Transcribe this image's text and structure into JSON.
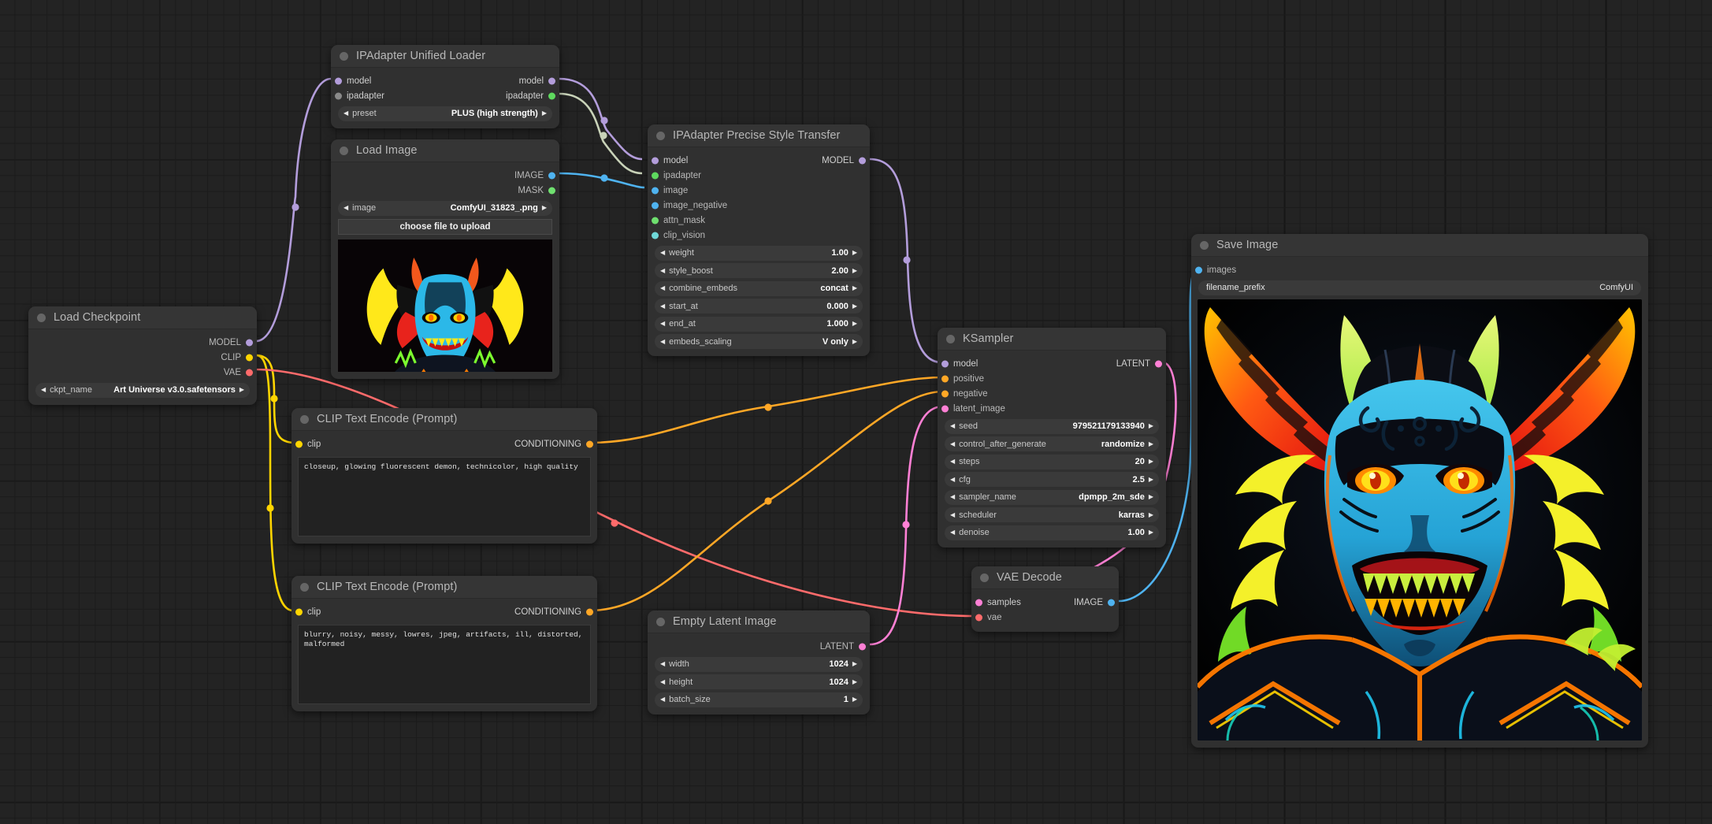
{
  "app": {
    "name": "ComfyUI",
    "canvas_bg": "#232323"
  },
  "colors": {
    "model": "#B39DDB",
    "clip": "#FFD500",
    "vae": "#FF6B6B",
    "conditioning": "#FFA726",
    "latent": "#FF80D5",
    "image": "#4FB3F0",
    "mask": "#6FE06F",
    "ipadapter": "#5ED95E",
    "clip_vision": "#6FD8D8"
  },
  "nodes": {
    "ipadapter_unified_loader": {
      "title": "IPAdapter Unified Loader",
      "inputs": [
        {
          "label": "model",
          "color": "#B39DDB"
        },
        {
          "label": "ipadapter",
          "color": "#8a8a8a"
        }
      ],
      "outputs": [
        {
          "label": "model",
          "color": "#B39DDB"
        },
        {
          "label": "ipadapter",
          "color": "#5ED95E"
        }
      ],
      "widgets": [
        {
          "label": "preset",
          "value": "PLUS (high strength)"
        }
      ]
    },
    "load_image": {
      "title": "Load Image",
      "outputs": [
        {
          "label": "IMAGE",
          "color": "#4FB3F0"
        },
        {
          "label": "MASK",
          "color": "#6FE06F"
        }
      ],
      "widgets": [
        {
          "label": "image",
          "value": "ComfyUI_31823_.png"
        }
      ],
      "upload_button": "choose file to upload",
      "preview_alt": "neon demon portrait thumbnail"
    },
    "ipadapter_precise_style_transfer": {
      "title": "IPAdapter Precise Style Transfer",
      "inputs": [
        {
          "label": "model",
          "color": "#B39DDB"
        },
        {
          "label": "ipadapter",
          "color": "#5ED95E"
        },
        {
          "label": "image",
          "color": "#4FB3F0"
        },
        {
          "label": "image_negative",
          "color": "#4FB3F0"
        },
        {
          "label": "attn_mask",
          "color": "#6FE06F"
        },
        {
          "label": "clip_vision",
          "color": "#6FD8D8"
        }
      ],
      "outputs": [
        {
          "label": "MODEL",
          "color": "#B39DDB"
        }
      ],
      "widgets": [
        {
          "label": "weight",
          "value": "1.00"
        },
        {
          "label": "style_boost",
          "value": "2.00"
        },
        {
          "label": "combine_embeds",
          "value": "concat"
        },
        {
          "label": "start_at",
          "value": "0.000"
        },
        {
          "label": "end_at",
          "value": "1.000"
        },
        {
          "label": "embeds_scaling",
          "value": "V only"
        }
      ]
    },
    "load_checkpoint": {
      "title": "Load Checkpoint",
      "outputs": [
        {
          "label": "MODEL",
          "color": "#B39DDB"
        },
        {
          "label": "CLIP",
          "color": "#FFD500"
        },
        {
          "label": "VAE",
          "color": "#FF6B6B"
        }
      ],
      "widgets": [
        {
          "label": "ckpt_name",
          "value": "Art Universe v3.0.safetensors"
        }
      ]
    },
    "clip_text_encode_positive": {
      "title": "CLIP Text Encode (Prompt)",
      "inputs": [
        {
          "label": "clip",
          "color": "#FFD500"
        }
      ],
      "outputs": [
        {
          "label": "CONDITIONING",
          "color": "#FFA726"
        }
      ],
      "text": "closeup, glowing fluorescent demon, technicolor, high quality"
    },
    "clip_text_encode_negative": {
      "title": "CLIP Text Encode (Prompt)",
      "inputs": [
        {
          "label": "clip",
          "color": "#FFD500"
        }
      ],
      "outputs": [
        {
          "label": "CONDITIONING",
          "color": "#FFA726"
        }
      ],
      "text": "blurry, noisy, messy, lowres, jpeg, artifacts, ill, distorted, malformed"
    },
    "ksampler": {
      "title": "KSampler",
      "inputs": [
        {
          "label": "model",
          "color": "#B39DDB"
        },
        {
          "label": "positive",
          "color": "#FFA726"
        },
        {
          "label": "negative",
          "color": "#FFA726"
        },
        {
          "label": "latent_image",
          "color": "#FF80D5"
        }
      ],
      "outputs": [
        {
          "label": "LATENT",
          "color": "#FF80D5"
        }
      ],
      "widgets": [
        {
          "label": "seed",
          "value": "979521179133940"
        },
        {
          "label": "control_after_generate",
          "value": "randomize"
        },
        {
          "label": "steps",
          "value": "20"
        },
        {
          "label": "cfg",
          "value": "2.5"
        },
        {
          "label": "sampler_name",
          "value": "dpmpp_2m_sde"
        },
        {
          "label": "scheduler",
          "value": "karras"
        },
        {
          "label": "denoise",
          "value": "1.00"
        }
      ]
    },
    "empty_latent_image": {
      "title": "Empty Latent Image",
      "outputs": [
        {
          "label": "LATENT",
          "color": "#FF80D5"
        }
      ],
      "widgets": [
        {
          "label": "width",
          "value": "1024"
        },
        {
          "label": "height",
          "value": "1024"
        },
        {
          "label": "batch_size",
          "value": "1"
        }
      ]
    },
    "vae_decode": {
      "title": "VAE Decode",
      "inputs": [
        {
          "label": "samples",
          "color": "#FF80D5"
        },
        {
          "label": "vae",
          "color": "#FF6B6B"
        }
      ],
      "outputs": [
        {
          "label": "IMAGE",
          "color": "#4FB3F0"
        }
      ]
    },
    "save_image": {
      "title": "Save Image",
      "inputs": [
        {
          "label": "images",
          "color": "#4FB3F0"
        }
      ],
      "widgets": [
        {
          "label": "filename_prefix",
          "value": "ComfyUI"
        }
      ],
      "preview_alt": "generated neon demon portrait"
    }
  }
}
